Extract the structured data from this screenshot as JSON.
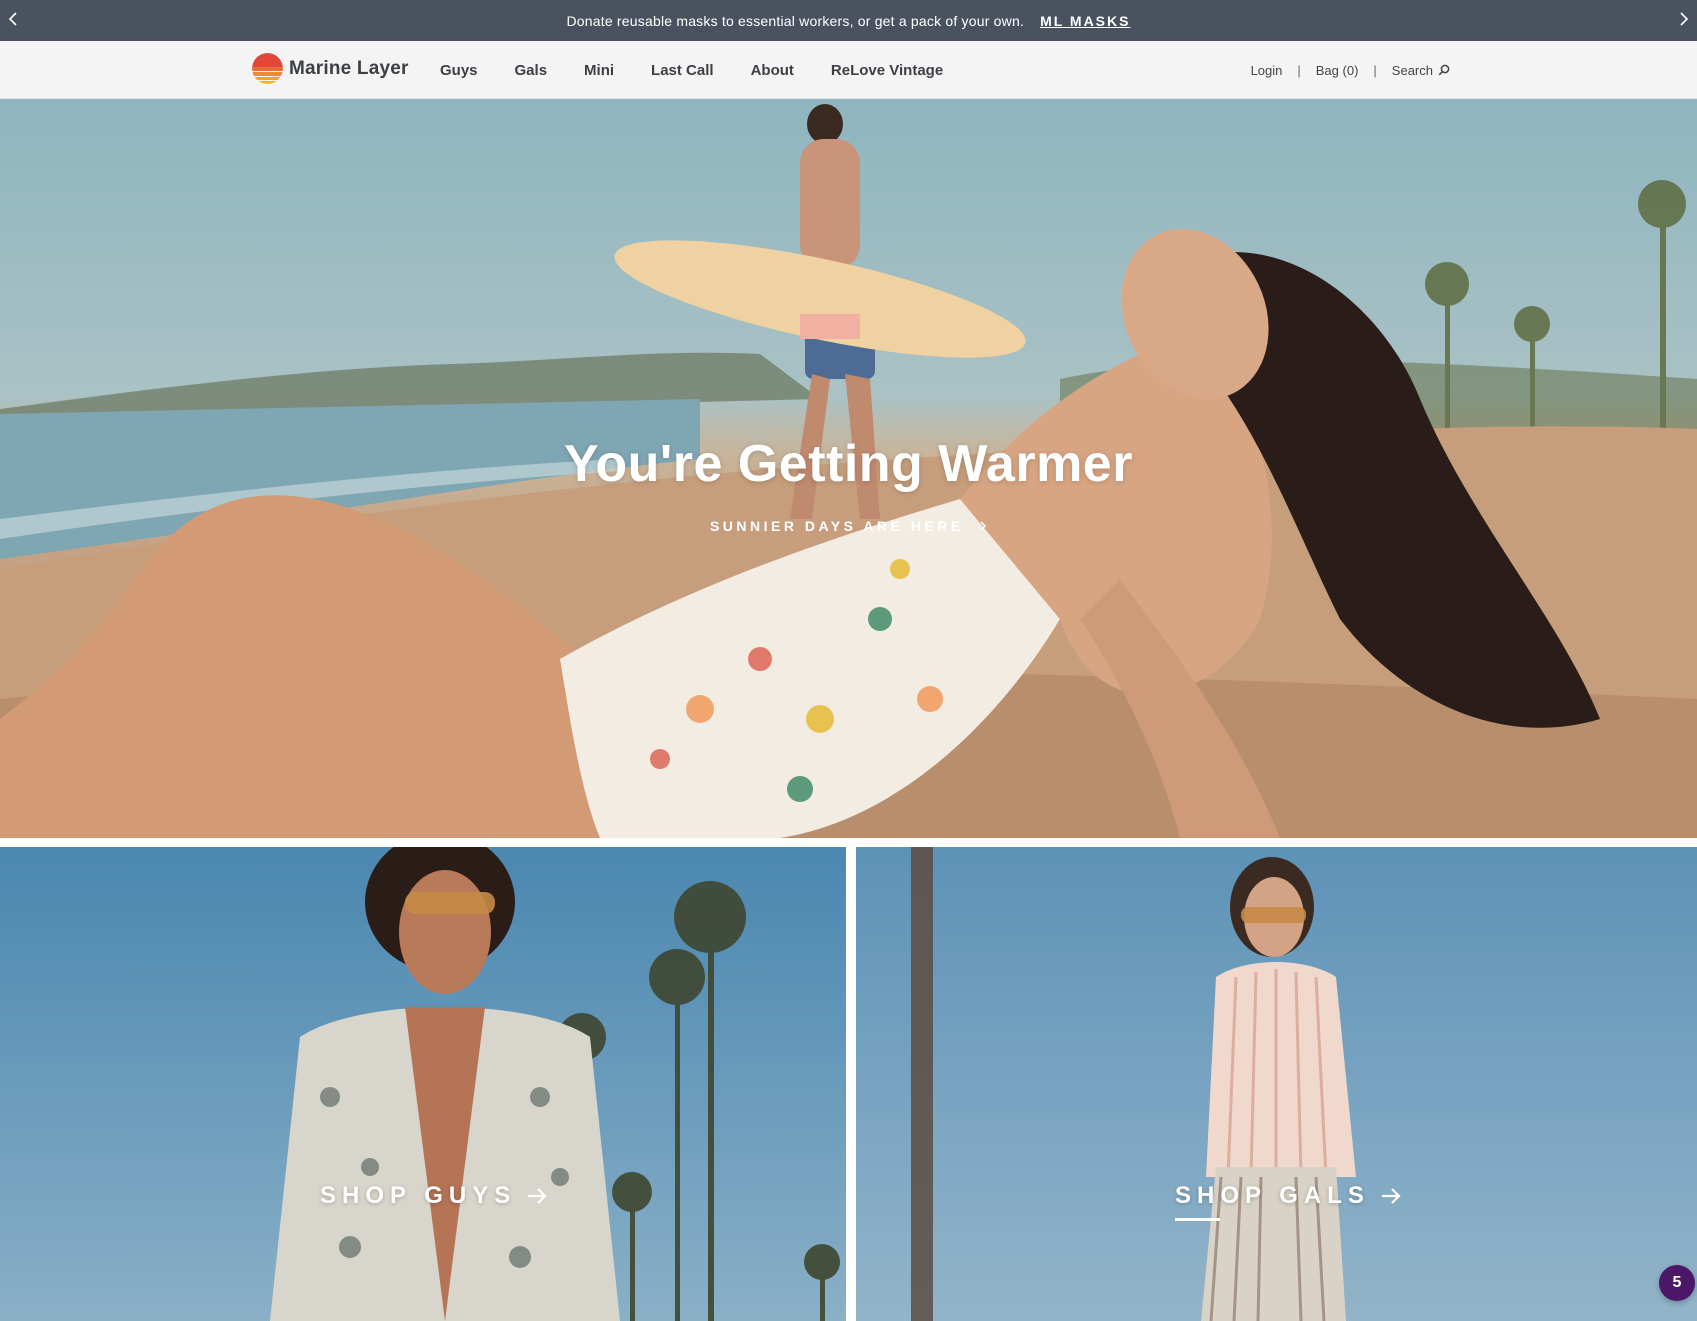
{
  "announcement": {
    "message": "Donate reusable masks to essential workers, or get a pack of your own.",
    "link_label": "ML MASKS",
    "prev_icon": "chevron-left-icon",
    "next_icon": "chevron-right-icon"
  },
  "header": {
    "brand_name": "Marine Layer",
    "logo_icon": "sunset-logo-icon",
    "nav": [
      "Guys",
      "Gals",
      "Mini",
      "Last Call",
      "About",
      "ReLove Vintage"
    ],
    "login_label": "Login",
    "bag_label": "Bag (0)",
    "search_label": "Search",
    "search_icon": "magnifier-icon",
    "separator": "|"
  },
  "hero": {
    "headline": "You're Getting Warmer",
    "cta_label": "SUNNIER DAYS ARE HERE",
    "cta_icon": "chevron-right-icon"
  },
  "tiles": {
    "guys_label": "SHOP GUYS",
    "gals_label": "SHOP GALS",
    "arrow_icon": "arrow-right-icon"
  },
  "badge": {
    "count": "5"
  },
  "colors": {
    "announcement_bg": "#4a5260",
    "header_bg": "#f4f4f4",
    "badge_bg": "#4b1766",
    "logo_top": "#e2473a",
    "logo_bottom": "#f5b52a"
  }
}
